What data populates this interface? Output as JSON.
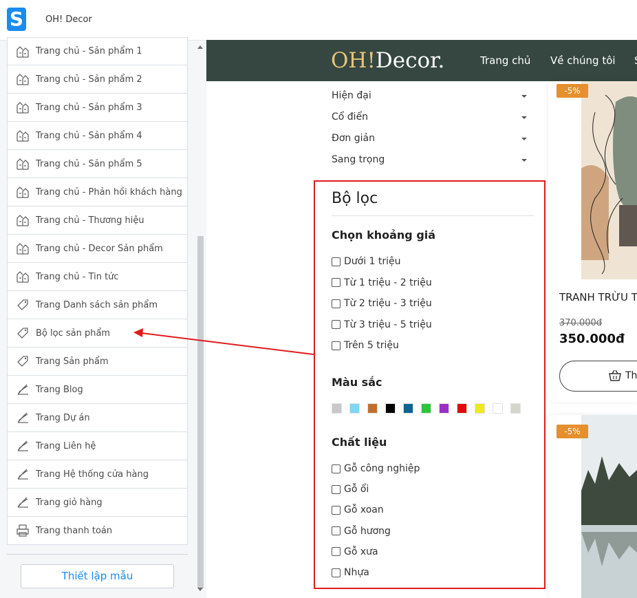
{
  "app": {
    "logo_letter": "S",
    "name": "OH! Decor"
  },
  "sidebar": {
    "items": [
      {
        "label": "Trang chủ - Sản phẩm 1",
        "icon": "home-icon"
      },
      {
        "label": "Trang chủ - Sản phẩm 2",
        "icon": "home-icon"
      },
      {
        "label": "Trang chủ - Sản phẩm 3",
        "icon": "home-icon"
      },
      {
        "label": "Trang chủ - Sản phẩm 4",
        "icon": "home-icon"
      },
      {
        "label": "Trang chủ - Sản phẩm 5",
        "icon": "home-icon"
      },
      {
        "label": "Trang chủ - Phản hồi khách hàng",
        "icon": "home-icon"
      },
      {
        "label": "Trang chủ - Thương hiệu",
        "icon": "home-icon"
      },
      {
        "label": "Trang chủ - Decor Sản phẩm",
        "icon": "home-icon"
      },
      {
        "label": "Trang chủ - Tin tức",
        "icon": "home-icon"
      },
      {
        "label": "Trang Danh sách sản phẩm",
        "icon": "tag-icon"
      },
      {
        "label": "Bộ lọc sản phẩm",
        "icon": "tag-icon"
      },
      {
        "label": "Trang Sản phẩm",
        "icon": "tag-icon"
      },
      {
        "label": "Trang Blog",
        "icon": "brush-icon"
      },
      {
        "label": "Trang Dự án",
        "icon": "brush-icon"
      },
      {
        "label": "Trang Liên hệ",
        "icon": "brush-icon"
      },
      {
        "label": "Trang Hệ thống cửa hàng",
        "icon": "brush-icon"
      },
      {
        "label": "Trang giỏ hàng",
        "icon": "brush-icon"
      },
      {
        "label": "Trang thanh toán",
        "icon": "printer-icon"
      }
    ],
    "template_button": "Thiết lập mẫu"
  },
  "site": {
    "brand_oh": "OH!",
    "brand_rest": "Decor.",
    "nav": [
      "Trang chủ",
      "Về chúng tôi",
      "S"
    ],
    "categories": [
      "Hiện đại",
      "Cổ điển",
      "Đơn giản",
      "Sang trọng"
    ]
  },
  "filter": {
    "title": "Bộ lọc",
    "price_title": "Chọn khoảng giá",
    "prices": [
      "Dưới 1 triệu",
      "Từ 1 triệu - 2 triệu",
      "Từ 2 triệu - 3 triệu",
      "Từ 3 triệu - 5 triệu",
      "Trên 5 triệu"
    ],
    "color_title": "Màu sắc",
    "colors": [
      "#c8c8c8",
      "#7fd6f5",
      "#c0702e",
      "#000000",
      "#0d6496",
      "#2ec43a",
      "#9b2ec4",
      "#e00b0b",
      "#ece91f",
      "#ffffff",
      "#d6d6cc"
    ],
    "material_title": "Chất liệu",
    "materials": [
      "Gỗ công nghiệp",
      "Gỗ ổi",
      "Gỗ xoan",
      "Gỗ hương",
      "Gỗ xưa",
      "Nhựa"
    ]
  },
  "products": [
    {
      "badge": "-5%",
      "title": "TRANH TRỪU T",
      "old_price": "370.000đ",
      "price": "350.000đ",
      "button": "Th"
    },
    {
      "badge": "-5%"
    }
  ]
}
